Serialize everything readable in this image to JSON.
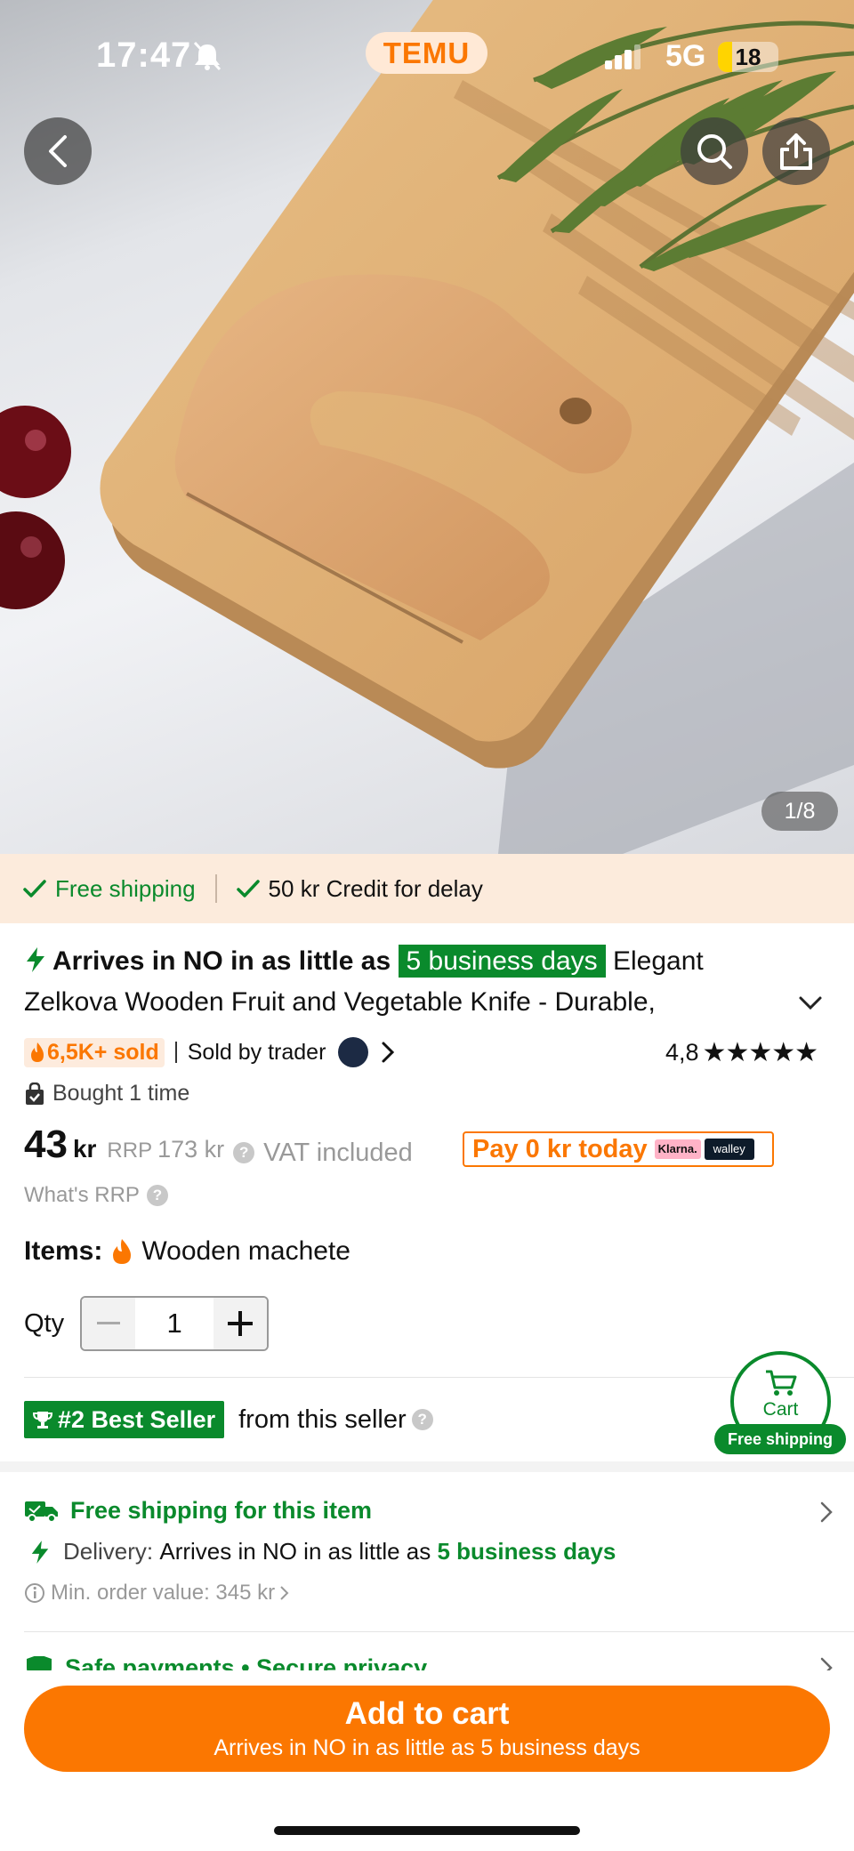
{
  "status_bar": {
    "time": "17:47",
    "app_name": "TEMU",
    "network": "5G",
    "battery": "18"
  },
  "hero": {
    "image_counter": "1/8"
  },
  "promo": {
    "free_shipping": "Free shipping",
    "credit": "50 kr Credit for delay"
  },
  "title": {
    "lead": "Arrives in NO in as little as",
    "highlight": "5 business days",
    "product_line1": "Elegant",
    "product_line2": "Zelkova Wooden Fruit and Vegetable Knife - Durable,"
  },
  "meta": {
    "sold": "6,5K+ sold",
    "sold_by": "Sold by trader",
    "rating": "4,8",
    "stars": "★★★★★"
  },
  "bought": "Bought 1 time",
  "price": {
    "amount": "43",
    "currency": "kr",
    "rrp_label": "RRP",
    "rrp_value": "173 kr",
    "vat": "VAT included",
    "pay_today": "Pay 0 kr today",
    "klarna": "Klarna.",
    "walley": "walley",
    "whats_rrp": "What's RRP"
  },
  "items": {
    "label": "Items:",
    "value": "Wooden machete"
  },
  "qty": {
    "label": "Qty",
    "value": "1"
  },
  "bestseller": {
    "badge": "#2 Best Seller",
    "text": "from this seller"
  },
  "cart_fab": {
    "label": "Cart",
    "badge": "Free shipping"
  },
  "shipping": {
    "title": "Free shipping for this item",
    "delivery_label": "Delivery:",
    "delivery_text": "Arrives in NO in as little as",
    "delivery_days": "5 business days",
    "min_order": "Min. order value: 345 kr"
  },
  "safe_payments": "Safe payments • Secure privacy",
  "add_to_cart": {
    "label": "Add to cart",
    "sub": "Arrives in NO in as little as 5 business days"
  },
  "colors": {
    "accent_orange": "#fb7701",
    "accent_green": "#0a8a2c"
  }
}
